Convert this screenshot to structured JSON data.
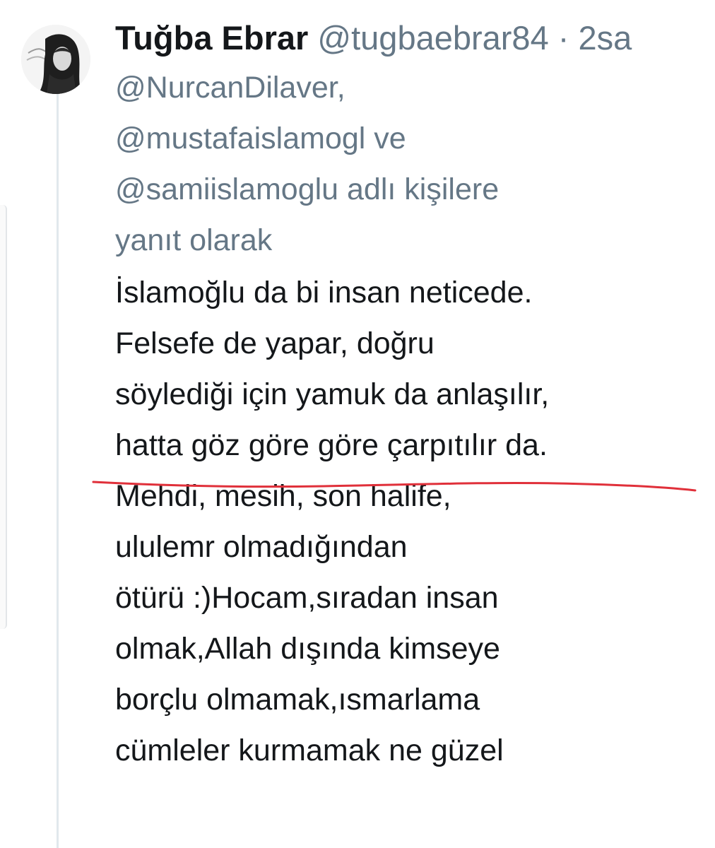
{
  "tweet": {
    "author_name": "Tuğba Ebrar",
    "author_handle": "@tugbaebrar84",
    "separator": "·",
    "time": "2sa",
    "reply_lines": [
      "@NurcanDilaver,",
      "@mustafaislamogl ve",
      "@samiislamoglu adlı kişilere",
      "yanıt olarak"
    ],
    "body_lines": [
      "İslamoğlu da bi insan neticede.",
      "Felsefe de yapar, doğru",
      "söylediği için yamuk da anlaşılır,",
      "hatta göz göre göre çarpıtılır da.",
      "Mehdi, mesih, son halife,",
      "ululemr olmadığından",
      "ötürü :)Hocam,sıradan insan",
      "olmak,Allah dışında kimseye",
      "borçlu olmamak,ısmarlama",
      "cümleler kurmamak ne güzel"
    ]
  },
  "colors": {
    "text": "#14171a",
    "secondary": "#657786",
    "thread_line": "#e1e8ed",
    "annotation": "#e0303a"
  },
  "icons": {
    "avatar": "avatar-photo"
  }
}
